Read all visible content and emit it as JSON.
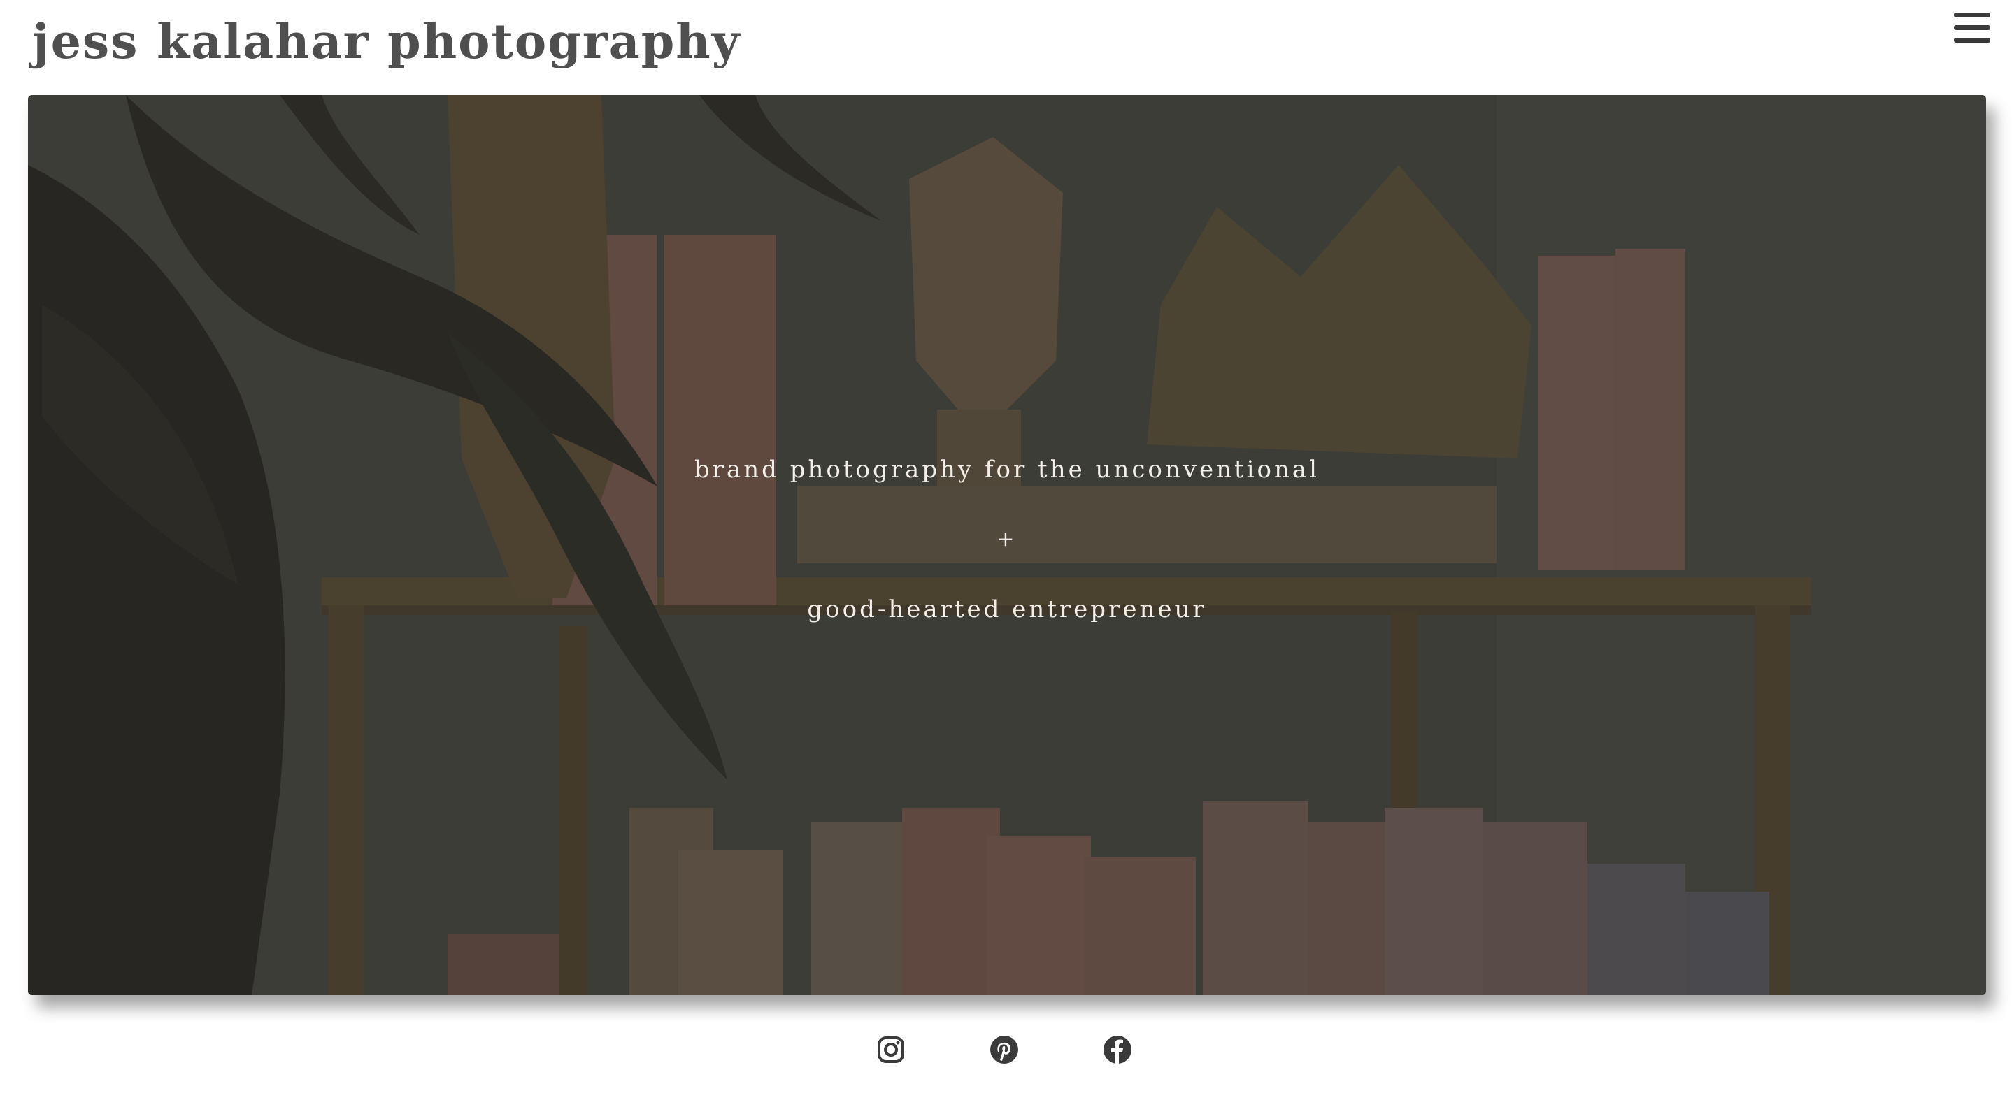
{
  "header": {
    "site_title": "jess kalahar photography",
    "menu_icon": "hamburger-menu-icon"
  },
  "hero": {
    "line_1": "brand photography for the unconventional",
    "separator": "+",
    "line_2": "good-hearted entrepreneur"
  },
  "social": {
    "items": [
      {
        "name": "instagram",
        "icon": "instagram-icon"
      },
      {
        "name": "pinterest",
        "icon": "pinterest-icon"
      },
      {
        "name": "facebook",
        "icon": "facebook-icon"
      }
    ]
  },
  "colors": {
    "title": "#4f4f4f",
    "hero_overlay": "#2e2d29",
    "hero_text": "#f2eee8",
    "icons": "#3a3a3a"
  }
}
